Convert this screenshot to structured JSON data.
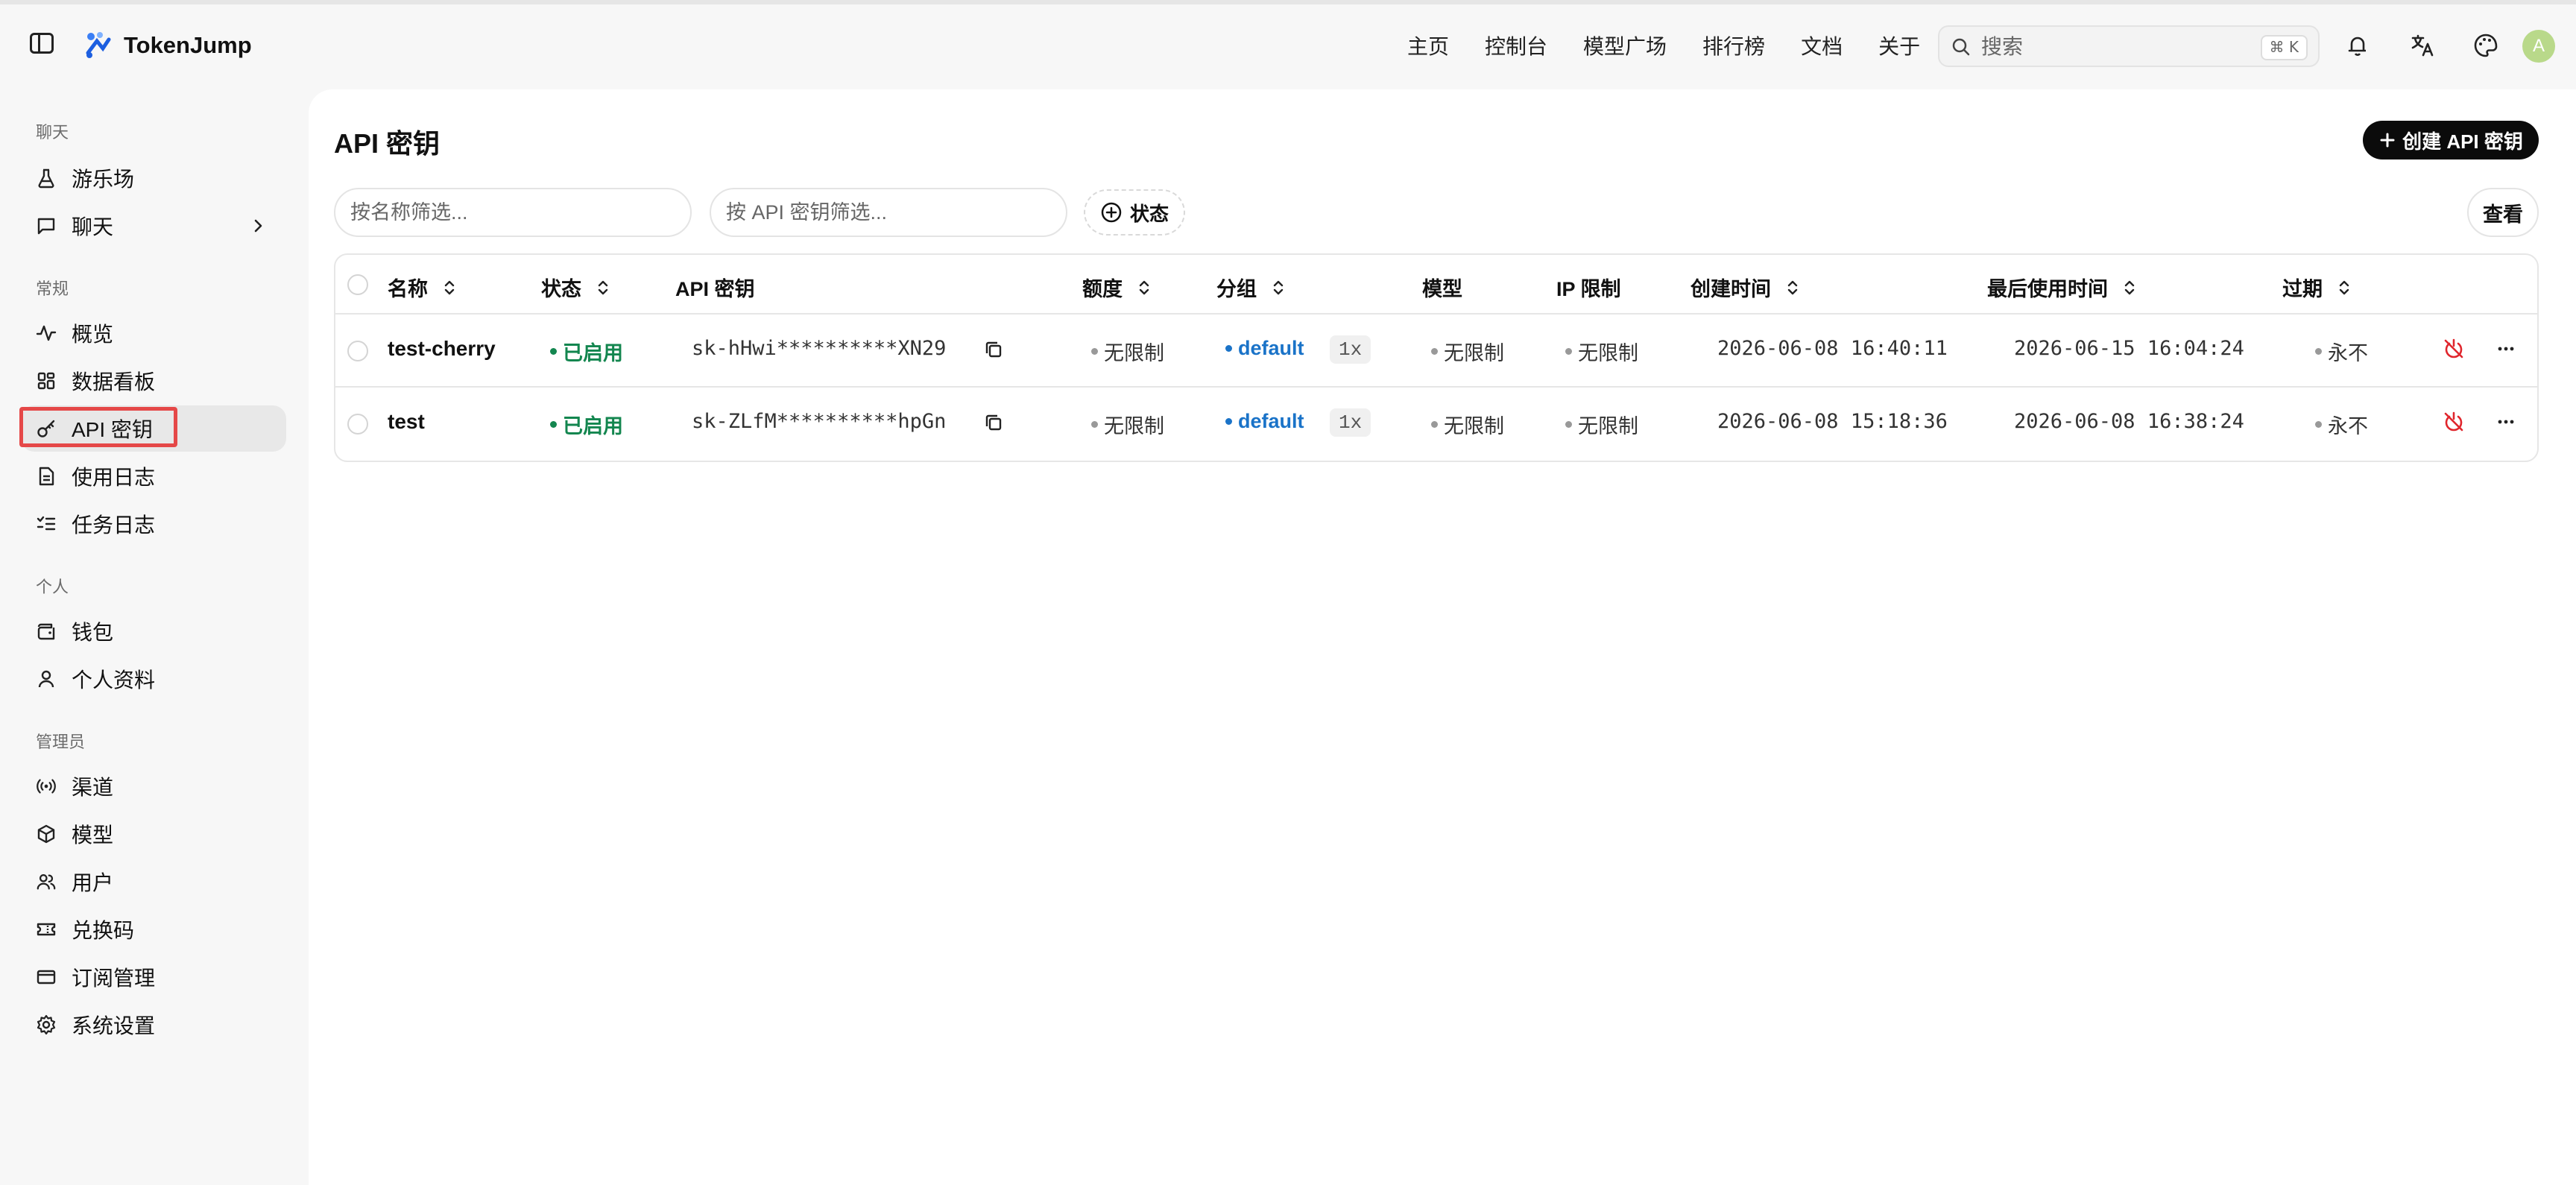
{
  "app": {
    "name": "TokenJump"
  },
  "nav": [
    "主页",
    "控制台",
    "模型广场",
    "排行榜",
    "文档",
    "关于"
  ],
  "search": {
    "placeholder": "搜索",
    "shortcut": "⌘ K"
  },
  "user": {
    "avatar_letter": "A"
  },
  "sidebar": {
    "sections": [
      {
        "title": "聊天",
        "items": [
          "游乐场",
          "聊天"
        ]
      },
      {
        "title": "常规",
        "items": [
          "概览",
          "数据看板",
          "API 密钥",
          "使用日志",
          "任务日志"
        ]
      },
      {
        "title": "个人",
        "items": [
          "钱包",
          "个人资料"
        ]
      },
      {
        "title": "管理员",
        "items": [
          "渠道",
          "模型",
          "用户",
          "兑换码",
          "订阅管理",
          "系统设置"
        ]
      }
    ],
    "active": "API 密钥"
  },
  "page": {
    "title": "API 密钥",
    "create_button": "创建 API 密钥",
    "filter_name_placeholder": "按名称筛选...",
    "filter_key_placeholder": "按 API 密钥筛选...",
    "status_filter": "状态",
    "view_button": "查看"
  },
  "table": {
    "columns": [
      "名称",
      "状态",
      "API 密钥",
      "额度",
      "分组",
      "模型",
      "IP 限制",
      "创建时间",
      "最后使用时间",
      "过期"
    ],
    "rows": [
      {
        "name": "test-cherry",
        "status": "已启用",
        "key": "sk-hHwi**********XN29",
        "quota": "无限制",
        "group": "default",
        "ratio": "1x",
        "models": "无限制",
        "ip": "无限制",
        "created": "2026-06-08 16:40:11",
        "last_used": "2026-06-15 16:04:24",
        "expires": "永不"
      },
      {
        "name": "test",
        "status": "已启用",
        "key": "sk-ZLfM**********hpGn",
        "quota": "无限制",
        "group": "default",
        "ratio": "1x",
        "models": "无限制",
        "ip": "无限制",
        "created": "2026-06-08 15:18:36",
        "last_used": "2026-06-08 16:38:24",
        "expires": "永不"
      }
    ]
  },
  "colors": {
    "accent": "#0b0b0b",
    "status_enabled": "#13864f",
    "group_blue": "#1a73c8",
    "disable_icon": "#e0262d",
    "highlight": "#e54848"
  }
}
